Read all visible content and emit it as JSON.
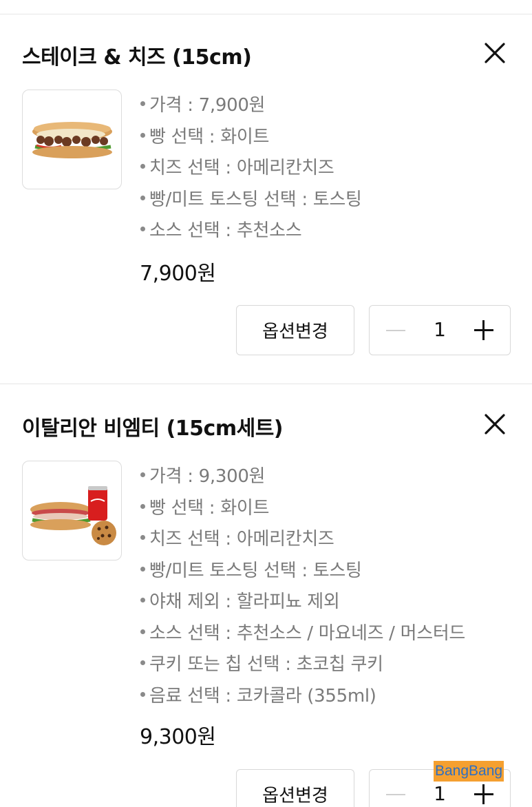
{
  "items": [
    {
      "title": "스테이크 & 치즈 (15cm)",
      "options": [
        "가격 : 7,900원",
        "빵 선택 : 화이트",
        "치즈 선택 : 아메리칸치즈",
        "빵/미트 토스팅 선택 : 토스팅",
        "소스 선택 : 추천소스"
      ],
      "price": "7,900원",
      "change_option_label": "옵션변경",
      "quantity": "1"
    },
    {
      "title": "이탈리안 비엠티 (15cm세트)",
      "options": [
        "가격 : 9,300원",
        "빵 선택 : 화이트",
        "치즈 선택 : 아메리칸치즈",
        "빵/미트 토스팅 선택 : 토스팅",
        "야채 제외 : 할라피뇨 제외",
        "소스 선택 : 추천소스 / 마요네즈 / 머스터드",
        "쿠키 또는 칩 선택 : 초코칩 쿠키",
        "음료 선택 : 코카콜라 (355ml)"
      ],
      "price": "9,300원",
      "change_option_label": "옵션변경",
      "quantity": "1"
    }
  ],
  "watermark": "BangBang",
  "icons": {
    "close": "close-icon",
    "minus": "minus-icon",
    "plus": "plus-icon"
  },
  "colors": {
    "text": "#111111",
    "muted": "#7a7a7a",
    "border": "#d8d8d8",
    "watermark_bg": "#f5a030",
    "watermark_text": "#2e6fc2"
  }
}
